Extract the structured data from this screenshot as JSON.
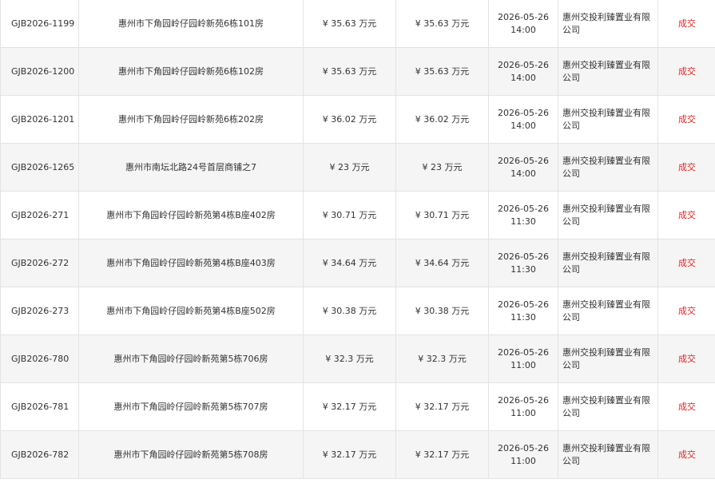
{
  "rows": [
    {
      "id": "GJB2026-1199",
      "name": "惠州市下角园岭仔园岭新苑6栋101房",
      "start_price": "¥ 35.63 万元",
      "final_price": "¥ 35.63 万元",
      "date": "2026-05-26",
      "time": "14:00",
      "company": "惠州交投利臻置业有限公司",
      "status": "成交"
    },
    {
      "id": "GJB2026-1200",
      "name": "惠州市下角园岭仔园岭新苑6栋102房",
      "start_price": "¥ 35.63 万元",
      "final_price": "¥ 35.63 万元",
      "date": "2026-05-26",
      "time": "14:00",
      "company": "惠州交投利臻置业有限公司",
      "status": "成交"
    },
    {
      "id": "GJB2026-1201",
      "name": "惠州市下角园岭仔园岭新苑6栋202房",
      "start_price": "¥ 36.02 万元",
      "final_price": "¥ 36.02 万元",
      "date": "2026-05-26",
      "time": "14:00",
      "company": "惠州交投利臻置业有限公司",
      "status": "成交"
    },
    {
      "id": "GJB2026-1265",
      "name": "惠州市南坛北路24号首层商铺之7",
      "start_price": "¥ 23 万元",
      "final_price": "¥ 23 万元",
      "date": "2026-05-26",
      "time": "14:00",
      "company": "惠州交投利臻置业有限公司",
      "status": "成交"
    },
    {
      "id": "GJB2026-271",
      "name": "惠州市下角园岭仔园岭新苑第4栋B座402房",
      "start_price": "¥ 30.71 万元",
      "final_price": "¥ 30.71 万元",
      "date": "2026-05-26",
      "time": "11:30",
      "company": "惠州交投利臻置业有限公司",
      "status": "成交"
    },
    {
      "id": "GJB2026-272",
      "name": "惠州市下角园岭仔园岭新苑第4栋B座403房",
      "start_price": "¥ 34.64 万元",
      "final_price": "¥ 34.64 万元",
      "date": "2026-05-26",
      "time": "11:30",
      "company": "惠州交投利臻置业有限公司",
      "status": "成交"
    },
    {
      "id": "GJB2026-273",
      "name": "惠州市下角园岭仔园岭新苑第4栋B座502房",
      "start_price": "¥ 30.38 万元",
      "final_price": "¥ 30.38 万元",
      "date": "2026-05-26",
      "time": "11:30",
      "company": "惠州交投利臻置业有限公司",
      "status": "成交"
    },
    {
      "id": "GJB2026-780",
      "name": "惠州市下角园岭仔园岭新苑第5栋706房",
      "start_price": "¥ 32.3 万元",
      "final_price": "¥ 32.3 万元",
      "date": "2026-05-26",
      "time": "11:00",
      "company": "惠州交投利臻置业有限公司",
      "status": "成交"
    },
    {
      "id": "GJB2026-781",
      "name": "惠州市下角园岭仔园岭新苑第5栋707房",
      "start_price": "¥ 32.17 万元",
      "final_price": "¥ 32.17 万元",
      "date": "2026-05-26",
      "time": "11:00",
      "company": "惠州交投利臻置业有限公司",
      "status": "成交"
    },
    {
      "id": "GJB2026-782",
      "name": "惠州市下角园岭仔园岭新苑第5栋708房",
      "start_price": "¥ 32.17 万元",
      "final_price": "¥ 32.17 万元",
      "date": "2026-05-26",
      "time": "11:00",
      "company": "惠州交投利臻置业有限公司",
      "status": "成交"
    }
  ]
}
